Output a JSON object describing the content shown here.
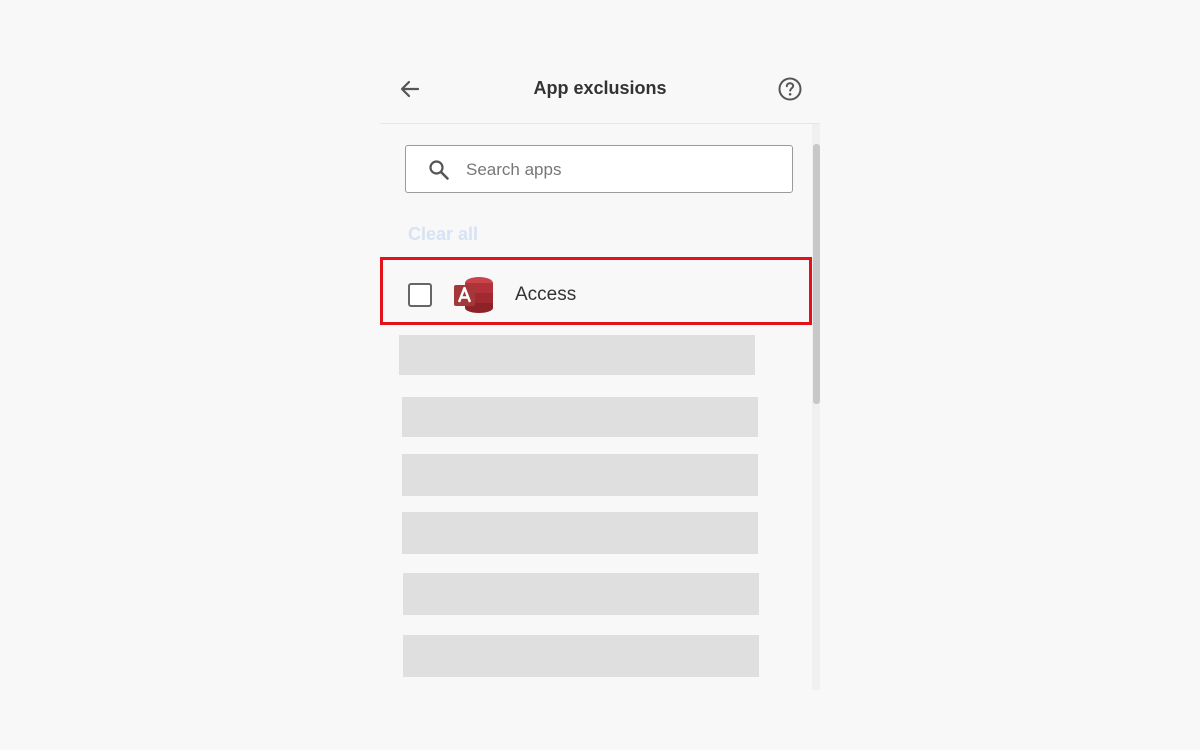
{
  "header": {
    "title": "App exclusions",
    "back_icon": "arrow-left-icon",
    "help_icon": "question-circle-icon"
  },
  "search": {
    "placeholder": "Search apps",
    "value": "",
    "icon": "search-icon"
  },
  "clear_all_label": "Clear all",
  "apps": [
    {
      "name": "Access",
      "checked": false,
      "icon": "microsoft-access-icon",
      "highlighted": true
    }
  ],
  "loading_placeholders": 6,
  "colors": {
    "highlight": "#e2111a",
    "clear_all": "#d6e3f4",
    "skeleton": "#dfdfdf",
    "access_brand": "#a4373a"
  }
}
